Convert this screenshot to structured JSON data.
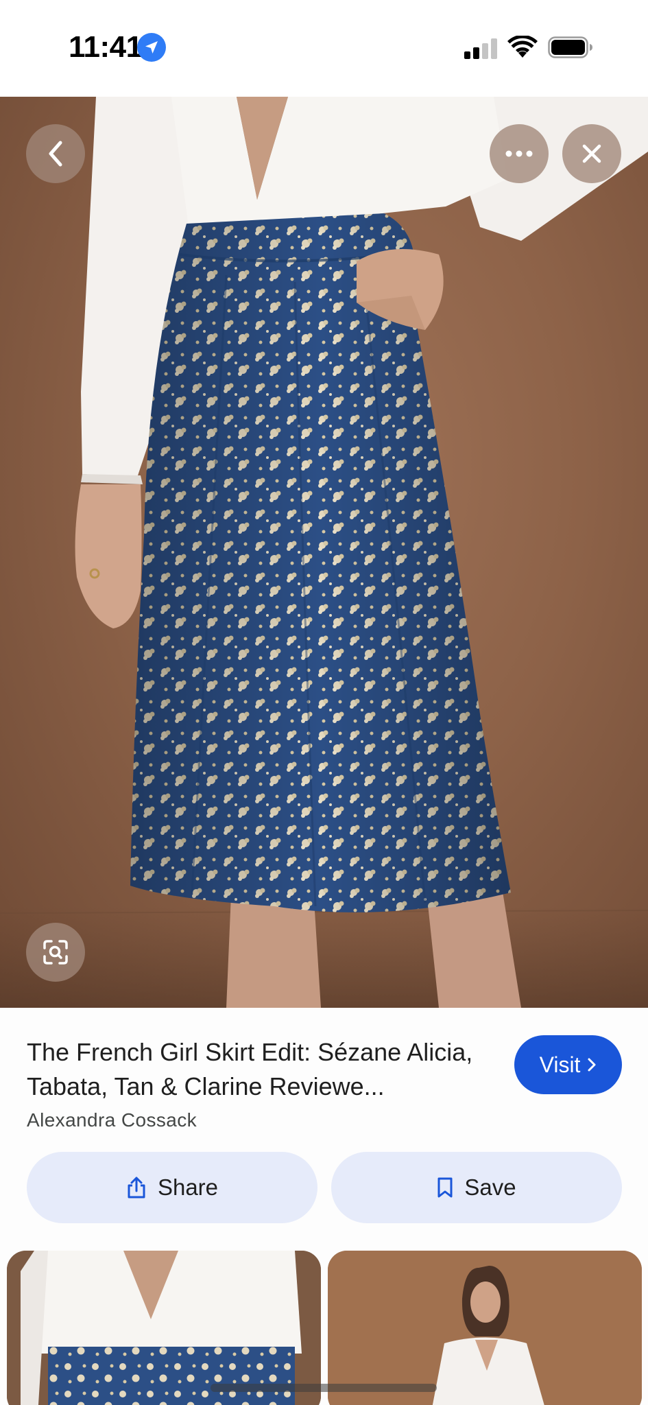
{
  "status_bar": {
    "time": "11:41",
    "icons": [
      "location-arrow-icon",
      "cellular-signal-icon",
      "wifi-icon",
      "battery-icon"
    ]
  },
  "viewer": {
    "top_controls": [
      "back-chevron-icon",
      "more-options-icon",
      "close-icon"
    ],
    "bottom_controls": [
      "lens-search-icon"
    ],
    "overlay_button_color": "#a08778"
  },
  "result": {
    "title": "The French Girl Skirt Edit: Sézane Alicia, Tabata, Tan & Clarine Reviewe...",
    "source": "Alexandra Cossack",
    "visit_label": "Visit"
  },
  "actions": {
    "share_label": "Share",
    "save_label": "Save"
  },
  "colors": {
    "visit_button": "#1a56d9",
    "action_button_bg": "#e6ebfa",
    "action_icon": "#1a56d9",
    "skirt_blue": "#2c4f86",
    "backdrop_brown": "#8d6248"
  },
  "related": {
    "thumbnails": [
      "skirt-closeup-thumbnail",
      "model-full-outfit-thumbnail"
    ]
  }
}
